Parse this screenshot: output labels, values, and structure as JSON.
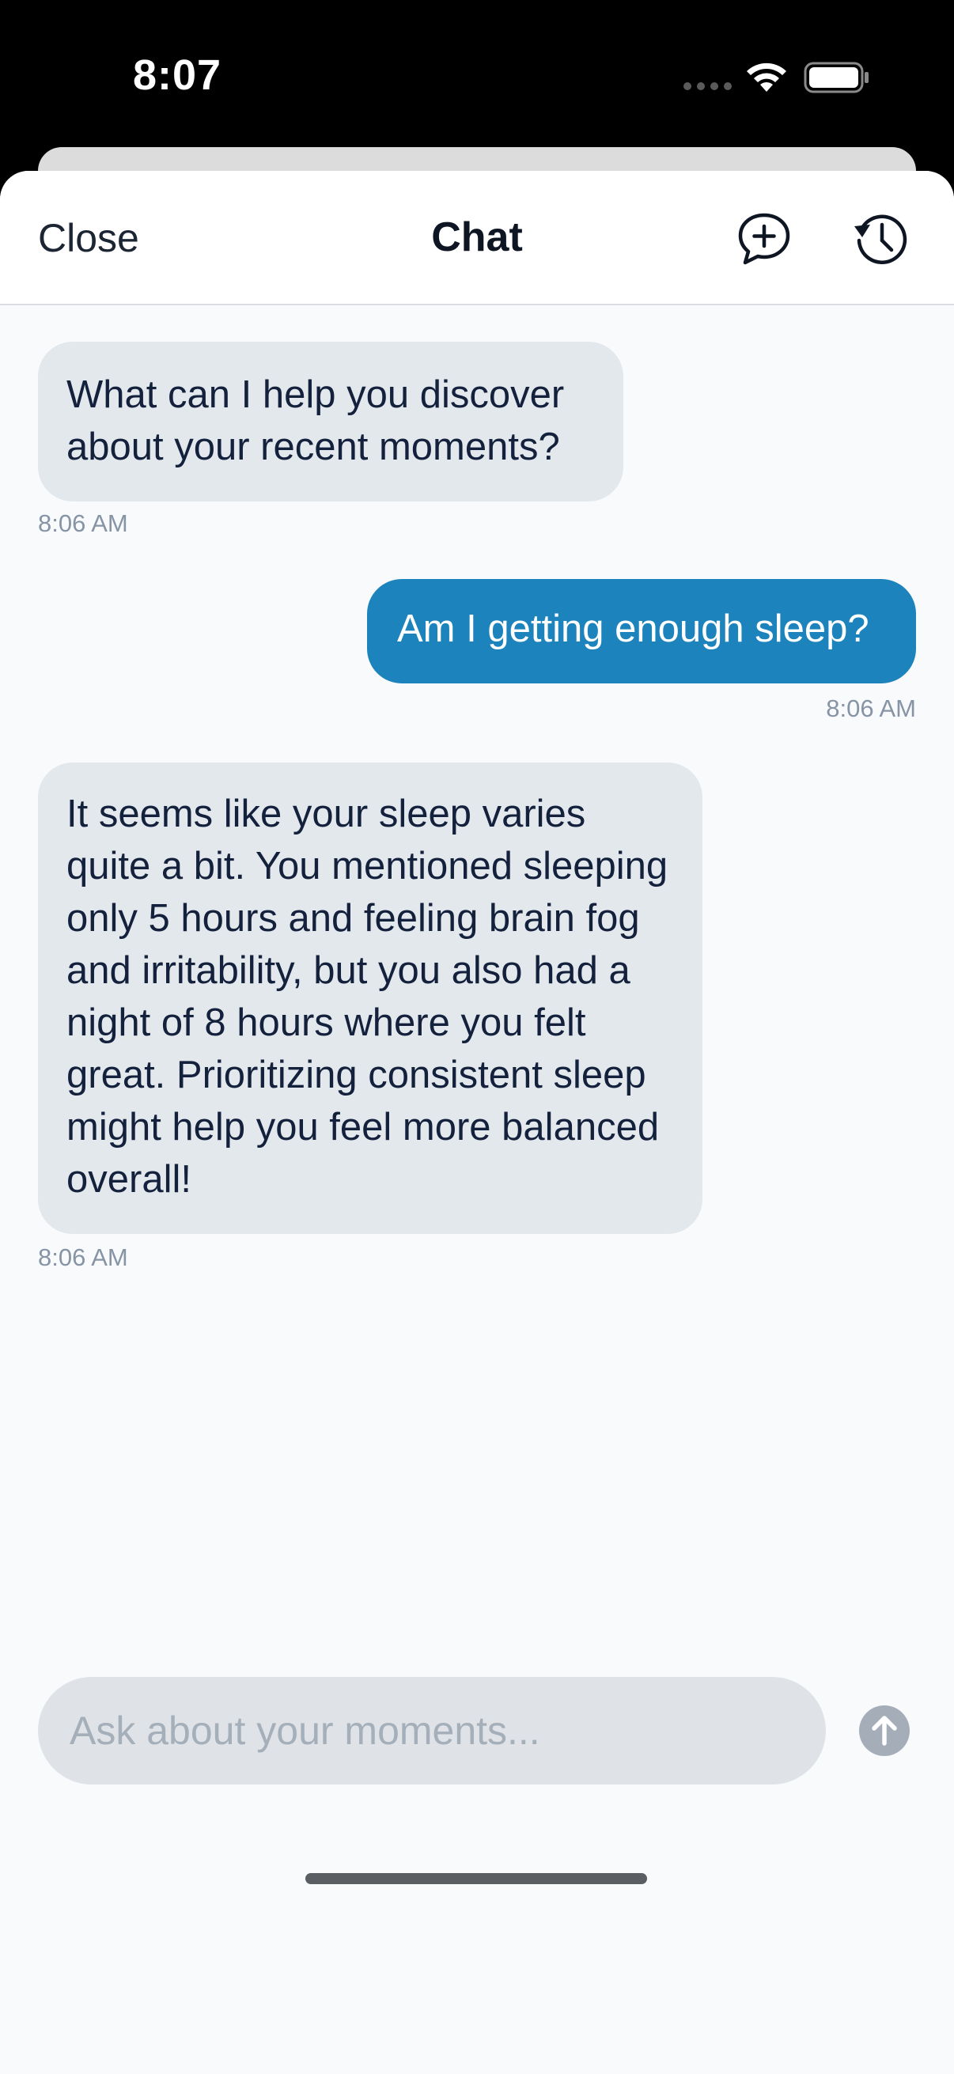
{
  "status_bar": {
    "time": "8:07",
    "icons": [
      "cellular-signal-icon",
      "wifi-icon",
      "battery-icon"
    ]
  },
  "nav": {
    "close_label": "Close",
    "title": "Chat",
    "new_chat_icon": "new-chat-icon",
    "history_icon": "history-icon"
  },
  "messages": [
    {
      "role": "assistant",
      "text": "What can I help you discover about your recent moments?",
      "time": "8:06 AM"
    },
    {
      "role": "user",
      "text": "Am I getting enough sleep?",
      "time": "8:06 AM"
    },
    {
      "role": "assistant",
      "text": "It seems like your sleep varies quite a bit. You mentioned sleeping only 5 hours and feeling brain fog and irritability, but you also had a night of 8 hours where you felt great. Prioritizing consistent sleep might help you feel more balanced overall!",
      "time": "8:06 AM"
    }
  ],
  "composer": {
    "placeholder": "Ask about your moments...",
    "value": "",
    "send_icon": "arrow-up-icon"
  },
  "colors": {
    "user_bubble": "#1c83bd",
    "assistant_bubble": "#e3e8ec",
    "background": "#f8fafc",
    "timestamp": "#8694a5"
  }
}
